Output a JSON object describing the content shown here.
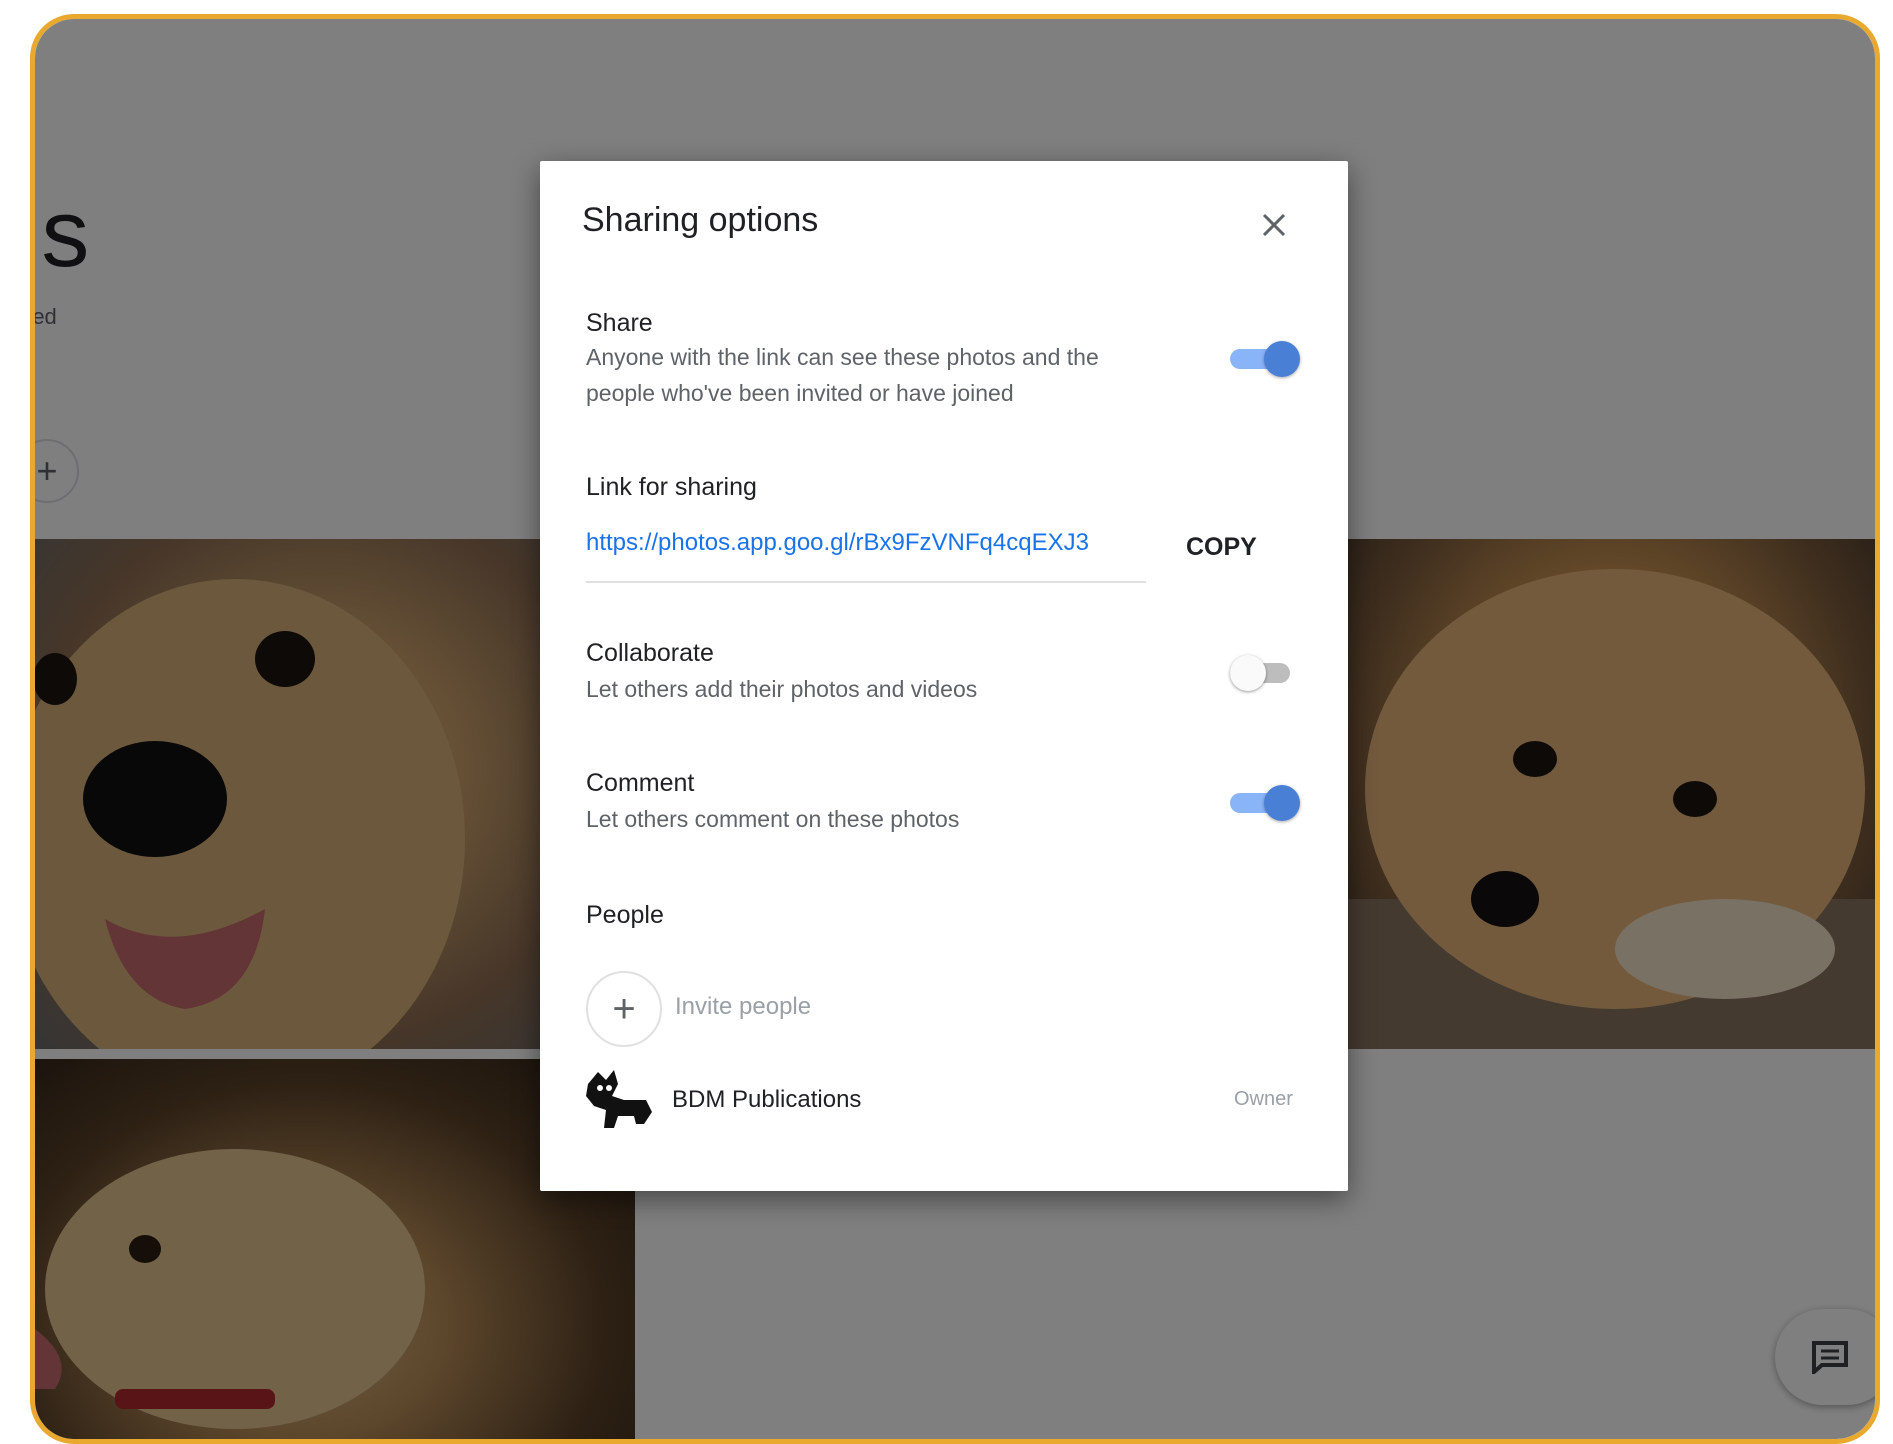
{
  "background": {
    "album_title_visible": "gs",
    "album_subtitle_visible": "red",
    "add_button_symbol": "+"
  },
  "dialog": {
    "title": "Sharing options",
    "close_icon": "close-icon",
    "share": {
      "title": "Share",
      "description": "Anyone with the link can see these photos and the people who've been invited or have joined",
      "enabled": true
    },
    "link": {
      "title": "Link for sharing",
      "url": "https://photos.app.goo.gl/rBx9FzVNFq4cqEXJ3",
      "copy_label": "COPY"
    },
    "collaborate": {
      "title": "Collaborate",
      "description": "Let others add their photos and videos",
      "enabled": false
    },
    "comment": {
      "title": "Comment",
      "description": "Let others comment on these photos",
      "enabled": true
    },
    "people": {
      "title": "People",
      "invite_symbol": "+",
      "invite_label": "Invite people",
      "members": [
        {
          "name": "BDM Publications",
          "role": "Owner"
        }
      ]
    }
  },
  "colors": {
    "frame_border": "#e8a92e",
    "toggle_on": "#4a7fd6",
    "link": "#1a73e8"
  }
}
